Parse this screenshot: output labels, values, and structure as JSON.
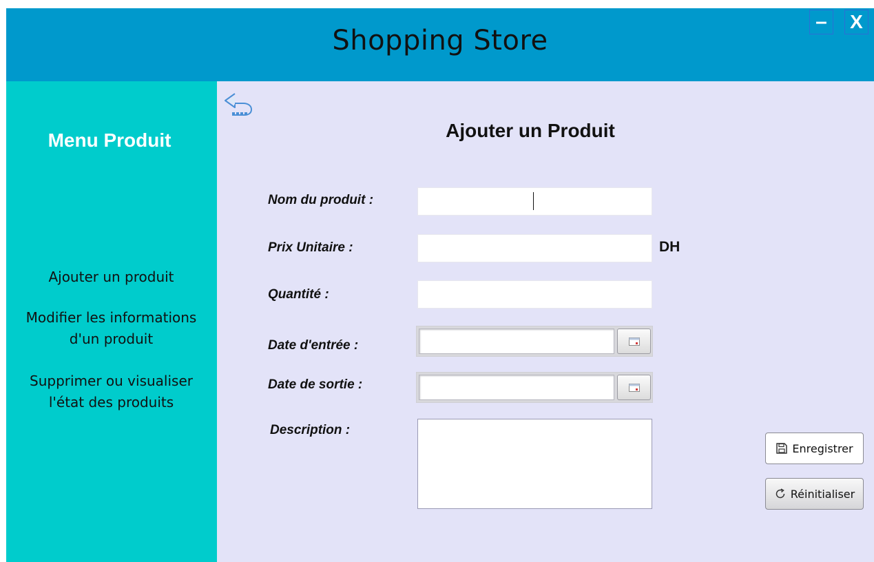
{
  "header": {
    "title": "Shopping Store",
    "minimize_label": "–",
    "close_label": "X",
    "bg_color": "#0099cc"
  },
  "sidebar": {
    "title": "Menu Produit",
    "bg_color": "#00cccc",
    "items": [
      {
        "line1": "Ajouter un produit",
        "line2": ""
      },
      {
        "line1": "Modifier les informations",
        "line2": "d'un produit"
      },
      {
        "line1": "Supprimer ou visualiser",
        "line2": "l'état des produits"
      }
    ]
  },
  "main": {
    "bg_color": "#e3e3f8",
    "back_icon": "back-arrow-icon",
    "title": "Ajouter un Produit",
    "fields": {
      "nom_label": "Nom du produit :",
      "nom_value": "",
      "prix_label": "Prix Unitaire :",
      "prix_value": "",
      "prix_unit": "DH",
      "quantite_label": "Quantité :",
      "quantite_value": "",
      "date_entree_label": "Date d'entrée :",
      "date_entree_value": "",
      "date_sortie_label": "Date de sortie :",
      "date_sortie_value": "",
      "description_label": "Description :",
      "description_value": ""
    },
    "buttons": {
      "save_label": "Enregistrer",
      "save_icon": "floppy-disk-icon",
      "reset_label": "Réinitialiser",
      "reset_icon": "refresh-icon"
    }
  }
}
